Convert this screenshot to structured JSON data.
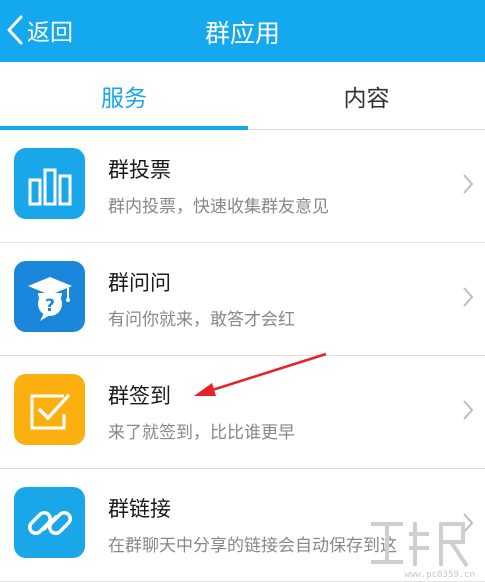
{
  "header": {
    "back_label": "返回",
    "title": "群应用"
  },
  "tabs": [
    {
      "label": "服务",
      "active": true
    },
    {
      "label": "内容",
      "active": false
    }
  ],
  "items": [
    {
      "title": "群投票",
      "description": "群内投票，快速收集群友意见",
      "icon": "bar-chart-icon",
      "color": "#1aa7ea"
    },
    {
      "title": "群问问",
      "description": "有问你就来，敢答才会红",
      "icon": "graduation-question-icon",
      "color": "#1a86dc"
    },
    {
      "title": "群签到",
      "description": "来了就签到，比比谁更早",
      "icon": "checkbox-icon",
      "color": "#fbb010"
    },
    {
      "title": "群链接",
      "description": "在群聊天中分享的链接会自动保存到这",
      "icon": "link-icon",
      "color": "#1aa7ea"
    }
  ],
  "colors": {
    "accent": "#14a8ee",
    "annotation_arrow": "#e8202a"
  },
  "watermark": {
    "site": "www.pc0359.cn"
  }
}
